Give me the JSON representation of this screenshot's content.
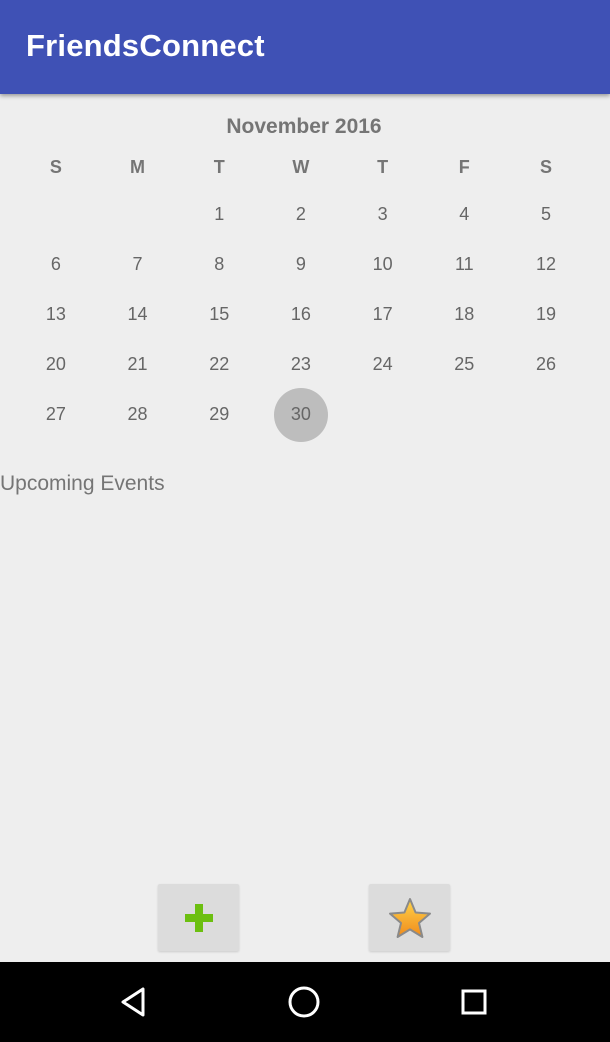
{
  "app": {
    "title": "FriendsConnect",
    "colors": {
      "primary": "#3f51b5",
      "background": "#eeeeee",
      "selected_day": "#bdbdbd",
      "add_icon": "#6cbf10",
      "star_icon": "#f5a623"
    }
  },
  "calendar": {
    "month_label": "November 2016",
    "weekdays": [
      "S",
      "M",
      "T",
      "W",
      "T",
      "F",
      "S"
    ],
    "weeks": [
      [
        "",
        "",
        "1",
        "2",
        "3",
        "4",
        "5"
      ],
      [
        "6",
        "7",
        "8",
        "9",
        "10",
        "11",
        "12"
      ],
      [
        "13",
        "14",
        "15",
        "16",
        "17",
        "18",
        "19"
      ],
      [
        "20",
        "21",
        "22",
        "23",
        "24",
        "25",
        "26"
      ],
      [
        "27",
        "28",
        "29",
        "30",
        "",
        "",
        ""
      ]
    ],
    "selected_day": "30"
  },
  "events": {
    "heading": "Upcoming Events"
  },
  "actions": {
    "add_icon": "plus-icon",
    "favorite_icon": "star-icon"
  },
  "system_nav": {
    "back_icon": "back-triangle-icon",
    "home_icon": "home-circle-icon",
    "recents_icon": "recents-square-icon"
  }
}
